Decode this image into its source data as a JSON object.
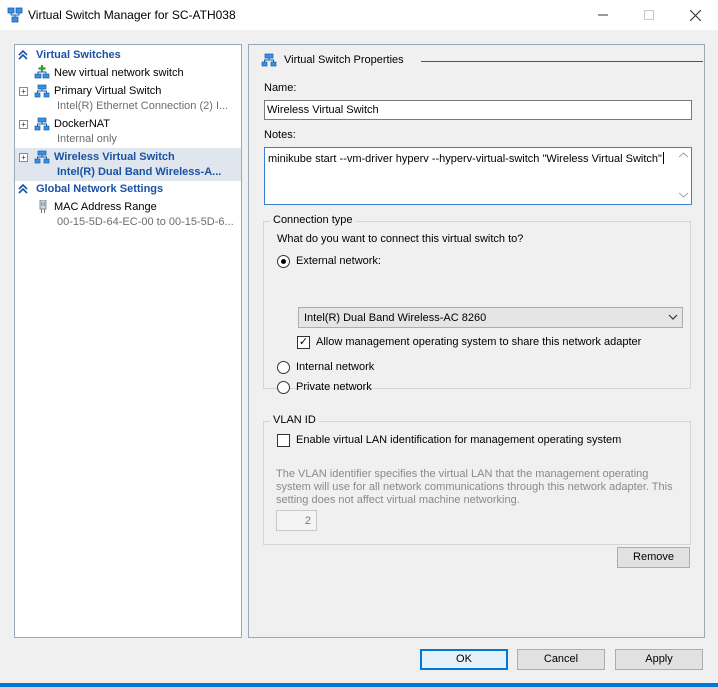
{
  "window": {
    "title": "Virtual Switch Manager for SC-ATH038"
  },
  "left_pane": {
    "virtual_switches_header": "Virtual Switches",
    "items": [
      {
        "name": "New virtual network switch",
        "sub": ""
      },
      {
        "name": "Primary Virtual Switch",
        "sub": "Intel(R) Ethernet Connection (2) I..."
      },
      {
        "name": "DockerNAT",
        "sub": "Internal only"
      },
      {
        "name": "Wireless Virtual Switch",
        "sub": "Intel(R) Dual Band Wireless-A..."
      }
    ],
    "global_header": "Global Network Settings",
    "mac": {
      "name": "MAC Address Range",
      "sub": "00-15-5D-64-EC-00 to 00-15-5D-6..."
    }
  },
  "properties": {
    "header": "Virtual Switch Properties",
    "name_label": "Name:",
    "name_value": "Wireless Virtual Switch",
    "notes_label": "Notes:",
    "notes_value": "minikube start --vm-driver hyperv --hyperv-virtual-switch \"Wireless Virtual Switch\"",
    "connection": {
      "legend": "Connection type",
      "question": "What do you want to connect this virtual switch to?",
      "external_label": "External network:",
      "adapter_selected": "Intel(R) Dual Band Wireless-AC 8260",
      "share_label": "Allow management operating system to share this network adapter",
      "internal_label": "Internal network",
      "private_label": "Private network"
    },
    "vlan": {
      "legend": "VLAN ID",
      "enable_label": "Enable virtual LAN identification for management operating system",
      "description": "The VLAN identifier specifies the virtual LAN that the management operating system will use for all network communications through this network adapter. This setting does not affect virtual machine networking.",
      "id_value": "2"
    },
    "remove_label": "Remove"
  },
  "footer": {
    "ok_label": "OK",
    "cancel_label": "Cancel",
    "apply_label": "Apply"
  }
}
